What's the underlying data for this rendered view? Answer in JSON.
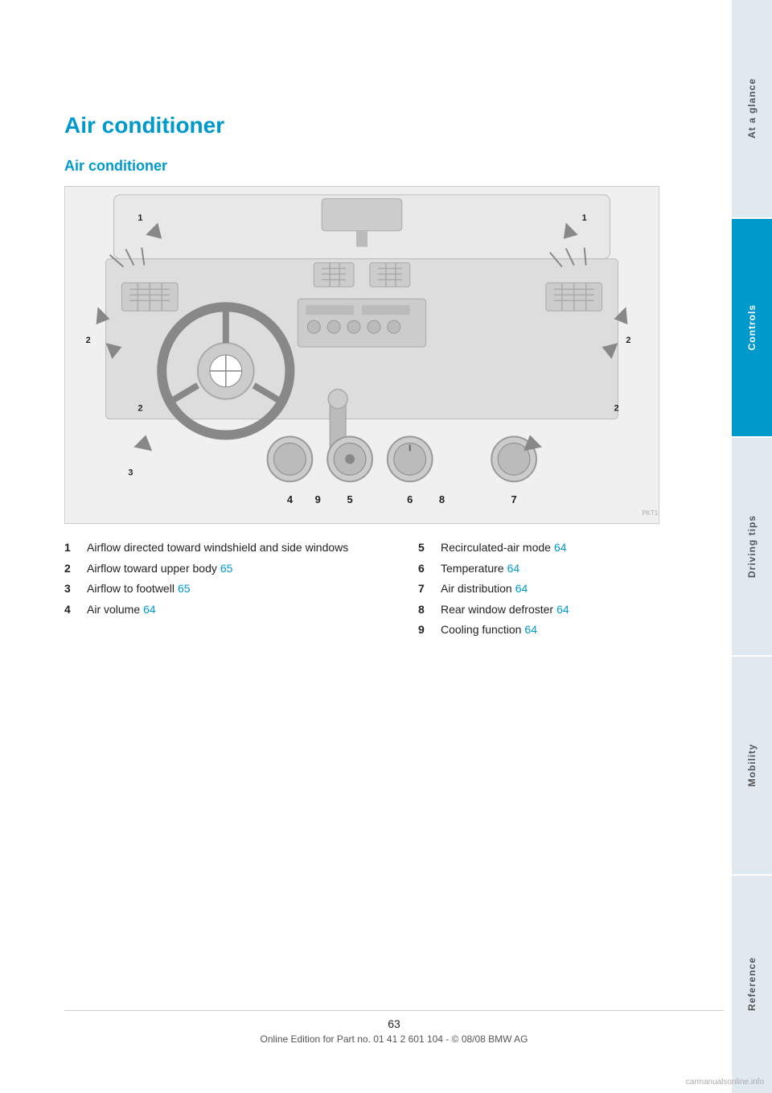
{
  "page": {
    "title": "Air conditioner",
    "section_title": "Air conditioner",
    "page_number": "63",
    "footer_text": "Online Edition for Part no. 01 41 2 601 104 - © 08/08 BMW AG"
  },
  "items": [
    {
      "number": "1",
      "text": "Airflow directed toward windshield and side windows",
      "page_ref": null
    },
    {
      "number": "2",
      "text": "Airflow toward upper body",
      "page_ref": "65"
    },
    {
      "number": "3",
      "text": "Airflow to footwell",
      "page_ref": "65"
    },
    {
      "number": "4",
      "text": "Air volume",
      "page_ref": "64"
    },
    {
      "number": "5",
      "text": "Recirculated-air mode",
      "page_ref": "64"
    },
    {
      "number": "6",
      "text": "Temperature",
      "page_ref": "64"
    },
    {
      "number": "7",
      "text": "Air distribution",
      "page_ref": "64"
    },
    {
      "number": "8",
      "text": "Rear window defroster",
      "page_ref": "64"
    },
    {
      "number": "9",
      "text": "Cooling function",
      "page_ref": "64"
    }
  ],
  "sidebar": {
    "sections": [
      {
        "label": "At a glance",
        "active": false
      },
      {
        "label": "Controls",
        "active": true
      },
      {
        "label": "Driving tips",
        "active": false
      },
      {
        "label": "Mobility",
        "active": false
      },
      {
        "label": "Reference",
        "active": false
      }
    ]
  }
}
